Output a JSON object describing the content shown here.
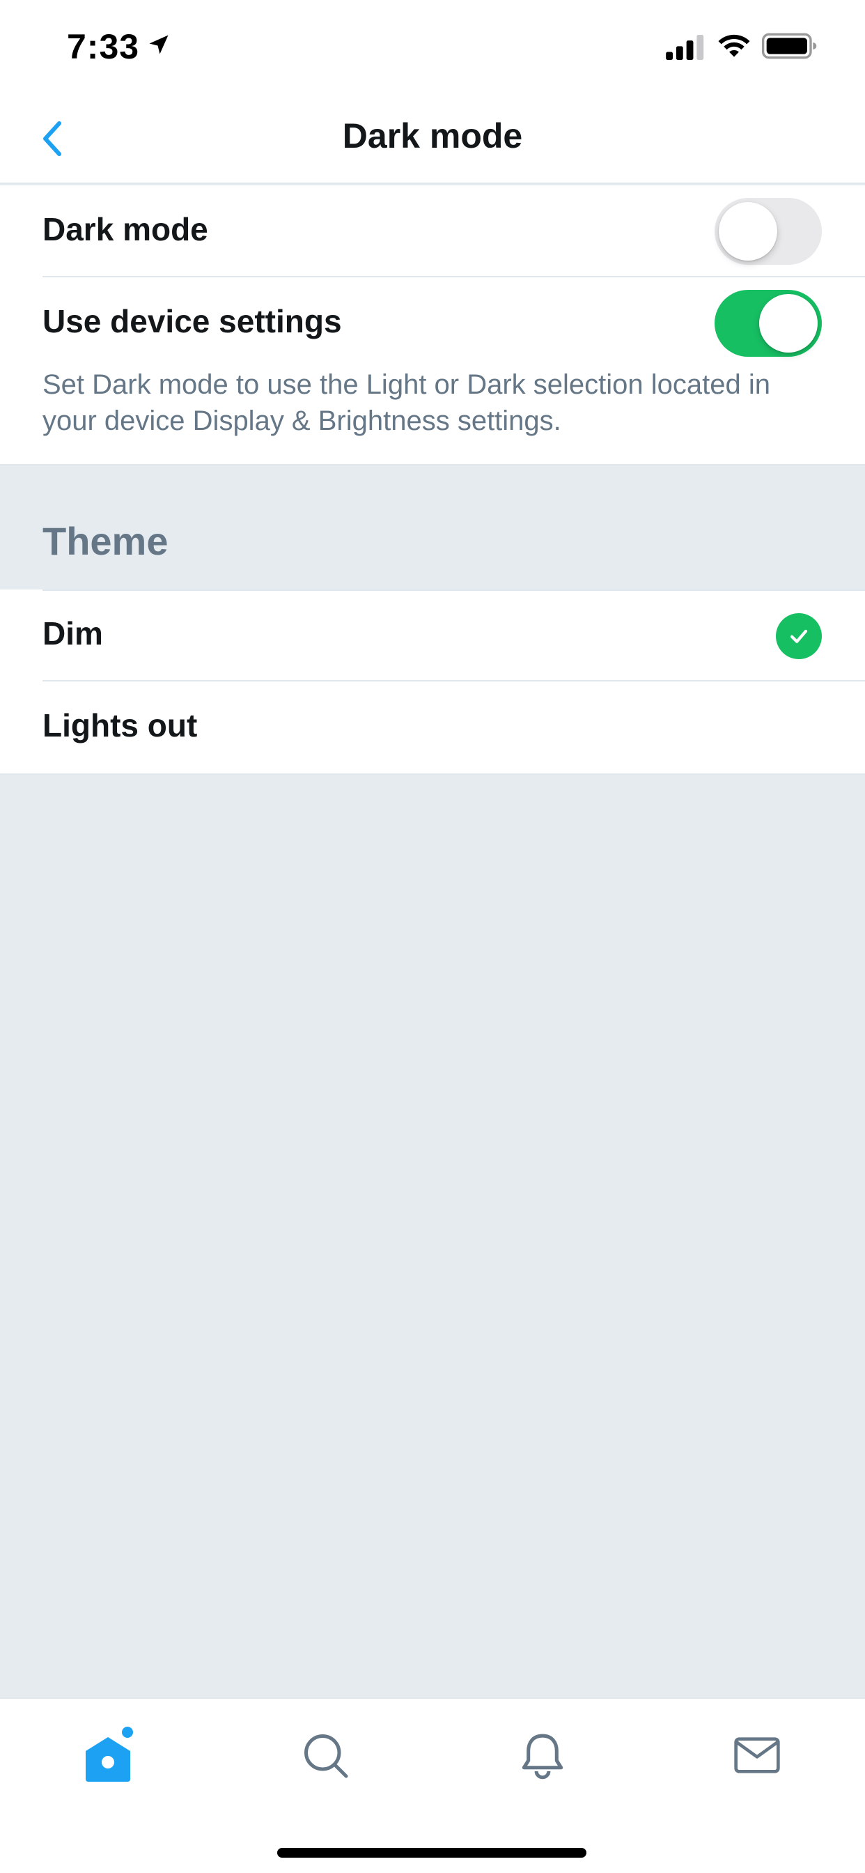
{
  "status_bar": {
    "time": "7:33"
  },
  "nav": {
    "title": "Dark mode",
    "back_icon": "chevron-left-icon"
  },
  "settings": {
    "dark_mode": {
      "label": "Dark mode",
      "enabled": false
    },
    "use_device_settings": {
      "label": "Use device settings",
      "enabled": true
    },
    "description": "Set Dark mode to use the Light or Dark selection located in your device Display & Brightness settings."
  },
  "theme": {
    "header": "Theme",
    "options": [
      {
        "label": "Dim",
        "selected": true
      },
      {
        "label": "Lights out",
        "selected": false
      }
    ]
  },
  "tab_bar": {
    "tabs": [
      {
        "icon": "home-icon",
        "active": true,
        "has_badge_dot": true
      },
      {
        "icon": "search-icon",
        "active": false
      },
      {
        "icon": "bell-icon",
        "active": false
      },
      {
        "icon": "mail-icon",
        "active": false
      }
    ]
  },
  "colors": {
    "accent": "#1da1f2",
    "toggle_on": "#17bf63",
    "secondary_text": "#657786",
    "background": "#e6ebf0"
  }
}
